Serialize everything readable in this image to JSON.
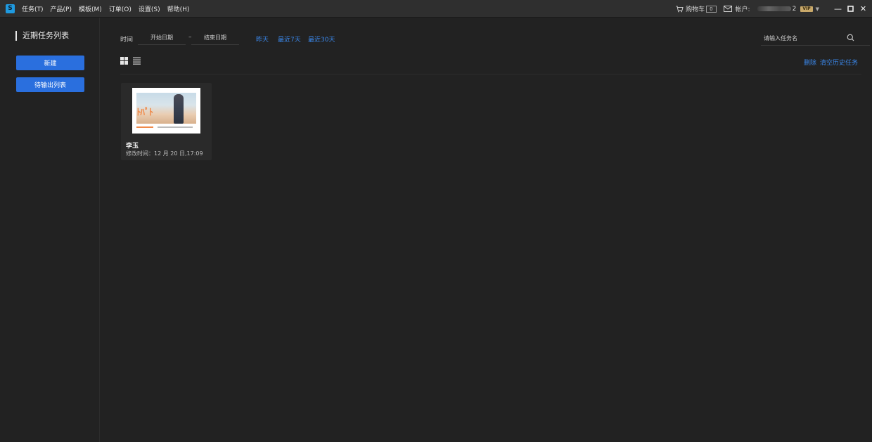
{
  "app": {
    "logo_letter": "S"
  },
  "menu": {
    "items": [
      {
        "label": "任务(T)"
      },
      {
        "label": "产品(P)"
      },
      {
        "label": "模板(M)"
      },
      {
        "label": "订单(O)"
      },
      {
        "label": "设置(S)"
      },
      {
        "label": "帮助(H)"
      }
    ]
  },
  "titlebar": {
    "cart_label": "购物车",
    "cart_count": "0",
    "account_label": "帐户:",
    "account_suffix": "2",
    "vip_label": "VIP",
    "minimize": "—",
    "maximize": "□",
    "close": "✕"
  },
  "sidebar": {
    "title": "近期任务列表",
    "new_button": "新建",
    "pending_button": "待输出列表"
  },
  "filters": {
    "time_label": "时间",
    "start_date_placeholder": "开始日期",
    "separator": "–",
    "end_date_placeholder": "结束日期",
    "quick": [
      "昨天",
      "最近7天",
      "最近30天"
    ]
  },
  "search": {
    "placeholder": "请输入任务名"
  },
  "actions": {
    "delete": "删除",
    "clear_history": "清空历史任务"
  },
  "tasks": [
    {
      "name": "李玉",
      "modified": "修改时间：12 月 20 日,17:09",
      "thumb_text": "ﾄﾊﾟﾄ"
    }
  ],
  "colors": {
    "accent": "#2a6fde",
    "link": "#3a86e8",
    "background": "#222222",
    "titlebar": "#2f2f2f"
  }
}
